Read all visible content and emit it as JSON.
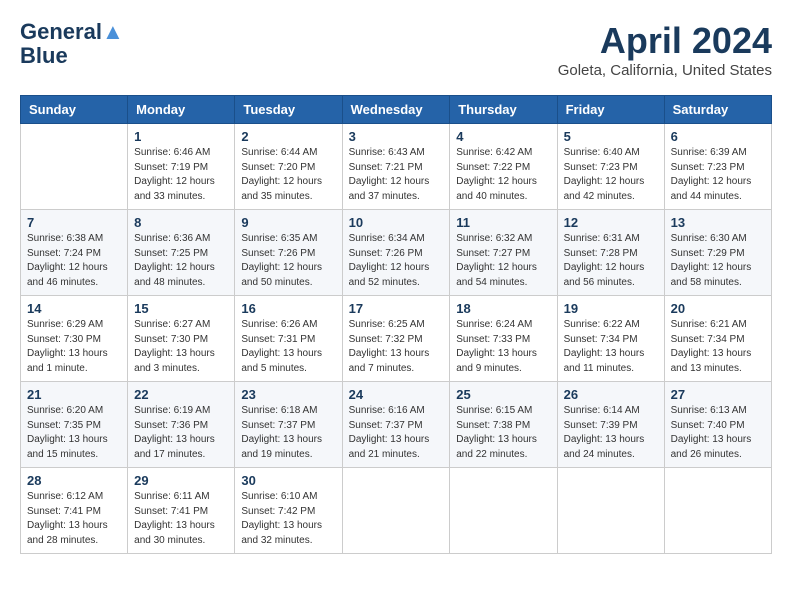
{
  "header": {
    "logo_line1": "General",
    "logo_line2": "Blue",
    "month": "April 2024",
    "location": "Goleta, California, United States"
  },
  "weekdays": [
    "Sunday",
    "Monday",
    "Tuesday",
    "Wednesday",
    "Thursday",
    "Friday",
    "Saturday"
  ],
  "weeks": [
    [
      {
        "day": "",
        "info": ""
      },
      {
        "day": "1",
        "info": "Sunrise: 6:46 AM\nSunset: 7:19 PM\nDaylight: 12 hours\nand 33 minutes."
      },
      {
        "day": "2",
        "info": "Sunrise: 6:44 AM\nSunset: 7:20 PM\nDaylight: 12 hours\nand 35 minutes."
      },
      {
        "day": "3",
        "info": "Sunrise: 6:43 AM\nSunset: 7:21 PM\nDaylight: 12 hours\nand 37 minutes."
      },
      {
        "day": "4",
        "info": "Sunrise: 6:42 AM\nSunset: 7:22 PM\nDaylight: 12 hours\nand 40 minutes."
      },
      {
        "day": "5",
        "info": "Sunrise: 6:40 AM\nSunset: 7:23 PM\nDaylight: 12 hours\nand 42 minutes."
      },
      {
        "day": "6",
        "info": "Sunrise: 6:39 AM\nSunset: 7:23 PM\nDaylight: 12 hours\nand 44 minutes."
      }
    ],
    [
      {
        "day": "7",
        "info": "Sunrise: 6:38 AM\nSunset: 7:24 PM\nDaylight: 12 hours\nand 46 minutes."
      },
      {
        "day": "8",
        "info": "Sunrise: 6:36 AM\nSunset: 7:25 PM\nDaylight: 12 hours\nand 48 minutes."
      },
      {
        "day": "9",
        "info": "Sunrise: 6:35 AM\nSunset: 7:26 PM\nDaylight: 12 hours\nand 50 minutes."
      },
      {
        "day": "10",
        "info": "Sunrise: 6:34 AM\nSunset: 7:26 PM\nDaylight: 12 hours\nand 52 minutes."
      },
      {
        "day": "11",
        "info": "Sunrise: 6:32 AM\nSunset: 7:27 PM\nDaylight: 12 hours\nand 54 minutes."
      },
      {
        "day": "12",
        "info": "Sunrise: 6:31 AM\nSunset: 7:28 PM\nDaylight: 12 hours\nand 56 minutes."
      },
      {
        "day": "13",
        "info": "Sunrise: 6:30 AM\nSunset: 7:29 PM\nDaylight: 12 hours\nand 58 minutes."
      }
    ],
    [
      {
        "day": "14",
        "info": "Sunrise: 6:29 AM\nSunset: 7:30 PM\nDaylight: 13 hours\nand 1 minute."
      },
      {
        "day": "15",
        "info": "Sunrise: 6:27 AM\nSunset: 7:30 PM\nDaylight: 13 hours\nand 3 minutes."
      },
      {
        "day": "16",
        "info": "Sunrise: 6:26 AM\nSunset: 7:31 PM\nDaylight: 13 hours\nand 5 minutes."
      },
      {
        "day": "17",
        "info": "Sunrise: 6:25 AM\nSunset: 7:32 PM\nDaylight: 13 hours\nand 7 minutes."
      },
      {
        "day": "18",
        "info": "Sunrise: 6:24 AM\nSunset: 7:33 PM\nDaylight: 13 hours\nand 9 minutes."
      },
      {
        "day": "19",
        "info": "Sunrise: 6:22 AM\nSunset: 7:34 PM\nDaylight: 13 hours\nand 11 minutes."
      },
      {
        "day": "20",
        "info": "Sunrise: 6:21 AM\nSunset: 7:34 PM\nDaylight: 13 hours\nand 13 minutes."
      }
    ],
    [
      {
        "day": "21",
        "info": "Sunrise: 6:20 AM\nSunset: 7:35 PM\nDaylight: 13 hours\nand 15 minutes."
      },
      {
        "day": "22",
        "info": "Sunrise: 6:19 AM\nSunset: 7:36 PM\nDaylight: 13 hours\nand 17 minutes."
      },
      {
        "day": "23",
        "info": "Sunrise: 6:18 AM\nSunset: 7:37 PM\nDaylight: 13 hours\nand 19 minutes."
      },
      {
        "day": "24",
        "info": "Sunrise: 6:16 AM\nSunset: 7:37 PM\nDaylight: 13 hours\nand 21 minutes."
      },
      {
        "day": "25",
        "info": "Sunrise: 6:15 AM\nSunset: 7:38 PM\nDaylight: 13 hours\nand 22 minutes."
      },
      {
        "day": "26",
        "info": "Sunrise: 6:14 AM\nSunset: 7:39 PM\nDaylight: 13 hours\nand 24 minutes."
      },
      {
        "day": "27",
        "info": "Sunrise: 6:13 AM\nSunset: 7:40 PM\nDaylight: 13 hours\nand 26 minutes."
      }
    ],
    [
      {
        "day": "28",
        "info": "Sunrise: 6:12 AM\nSunset: 7:41 PM\nDaylight: 13 hours\nand 28 minutes."
      },
      {
        "day": "29",
        "info": "Sunrise: 6:11 AM\nSunset: 7:41 PM\nDaylight: 13 hours\nand 30 minutes."
      },
      {
        "day": "30",
        "info": "Sunrise: 6:10 AM\nSunset: 7:42 PM\nDaylight: 13 hours\nand 32 minutes."
      },
      {
        "day": "",
        "info": ""
      },
      {
        "day": "",
        "info": ""
      },
      {
        "day": "",
        "info": ""
      },
      {
        "day": "",
        "info": ""
      }
    ]
  ]
}
